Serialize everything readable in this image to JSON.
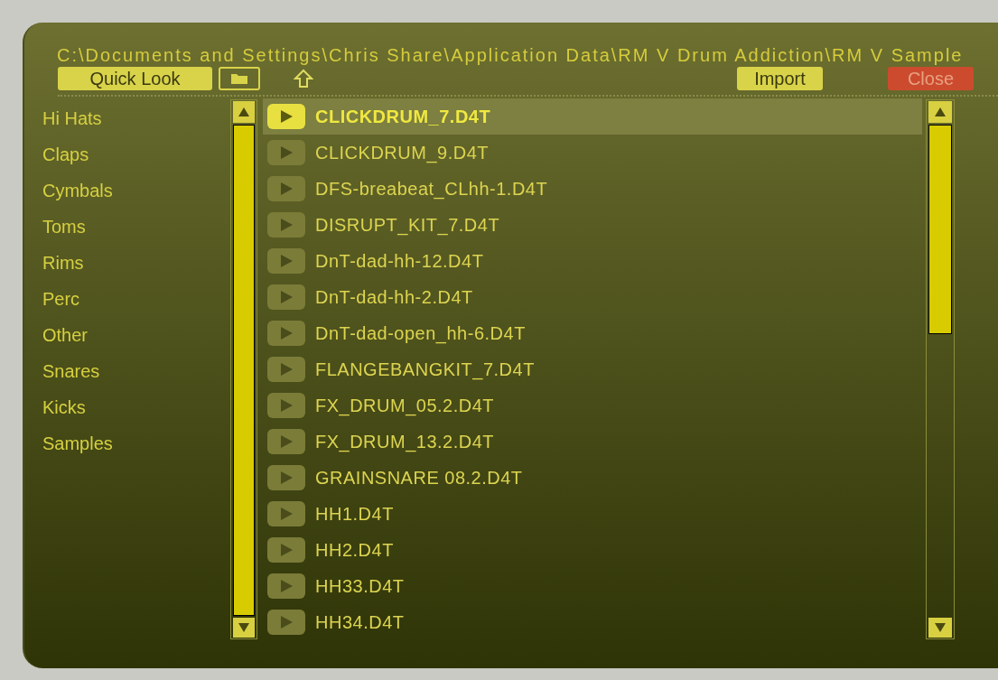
{
  "path": "C:\\Documents and Settings\\Chris Share\\Application Data\\RM V Drum Addiction\\RM V Sample",
  "toolbar": {
    "quick_look": "Quick Look",
    "import": "Import",
    "close": "Close"
  },
  "categories": [
    "Hi Hats",
    "Claps",
    "Cymbals",
    "Toms",
    "Rims",
    "Perc",
    "Other",
    "Snares",
    "Kicks",
    "Samples"
  ],
  "files": [
    {
      "name": "CLICKDRUM_7.D4T",
      "selected": true
    },
    {
      "name": "CLICKDRUM_9.D4T",
      "selected": false
    },
    {
      "name": "DFS-breabeat_CLhh-1.D4T",
      "selected": false
    },
    {
      "name": "DISRUPT_KIT_7.D4T",
      "selected": false
    },
    {
      "name": "DnT-dad-hh-12.D4T",
      "selected": false
    },
    {
      "name": "DnT-dad-hh-2.D4T",
      "selected": false
    },
    {
      "name": "DnT-dad-open_hh-6.D4T",
      "selected": false
    },
    {
      "name": "FLANGEBANGKIT_7.D4T",
      "selected": false
    },
    {
      "name": "FX_DRUM_05.2.D4T",
      "selected": false
    },
    {
      "name": "FX_DRUM_13.2.D4T",
      "selected": false
    },
    {
      "name": "GRAINSNARE 08.2.D4T",
      "selected": false
    },
    {
      "name": "HH1.D4T",
      "selected": false
    },
    {
      "name": "HH2.D4T",
      "selected": false
    },
    {
      "name": "HH33.D4T",
      "selected": false
    },
    {
      "name": "HH34.D4T",
      "selected": false
    }
  ]
}
